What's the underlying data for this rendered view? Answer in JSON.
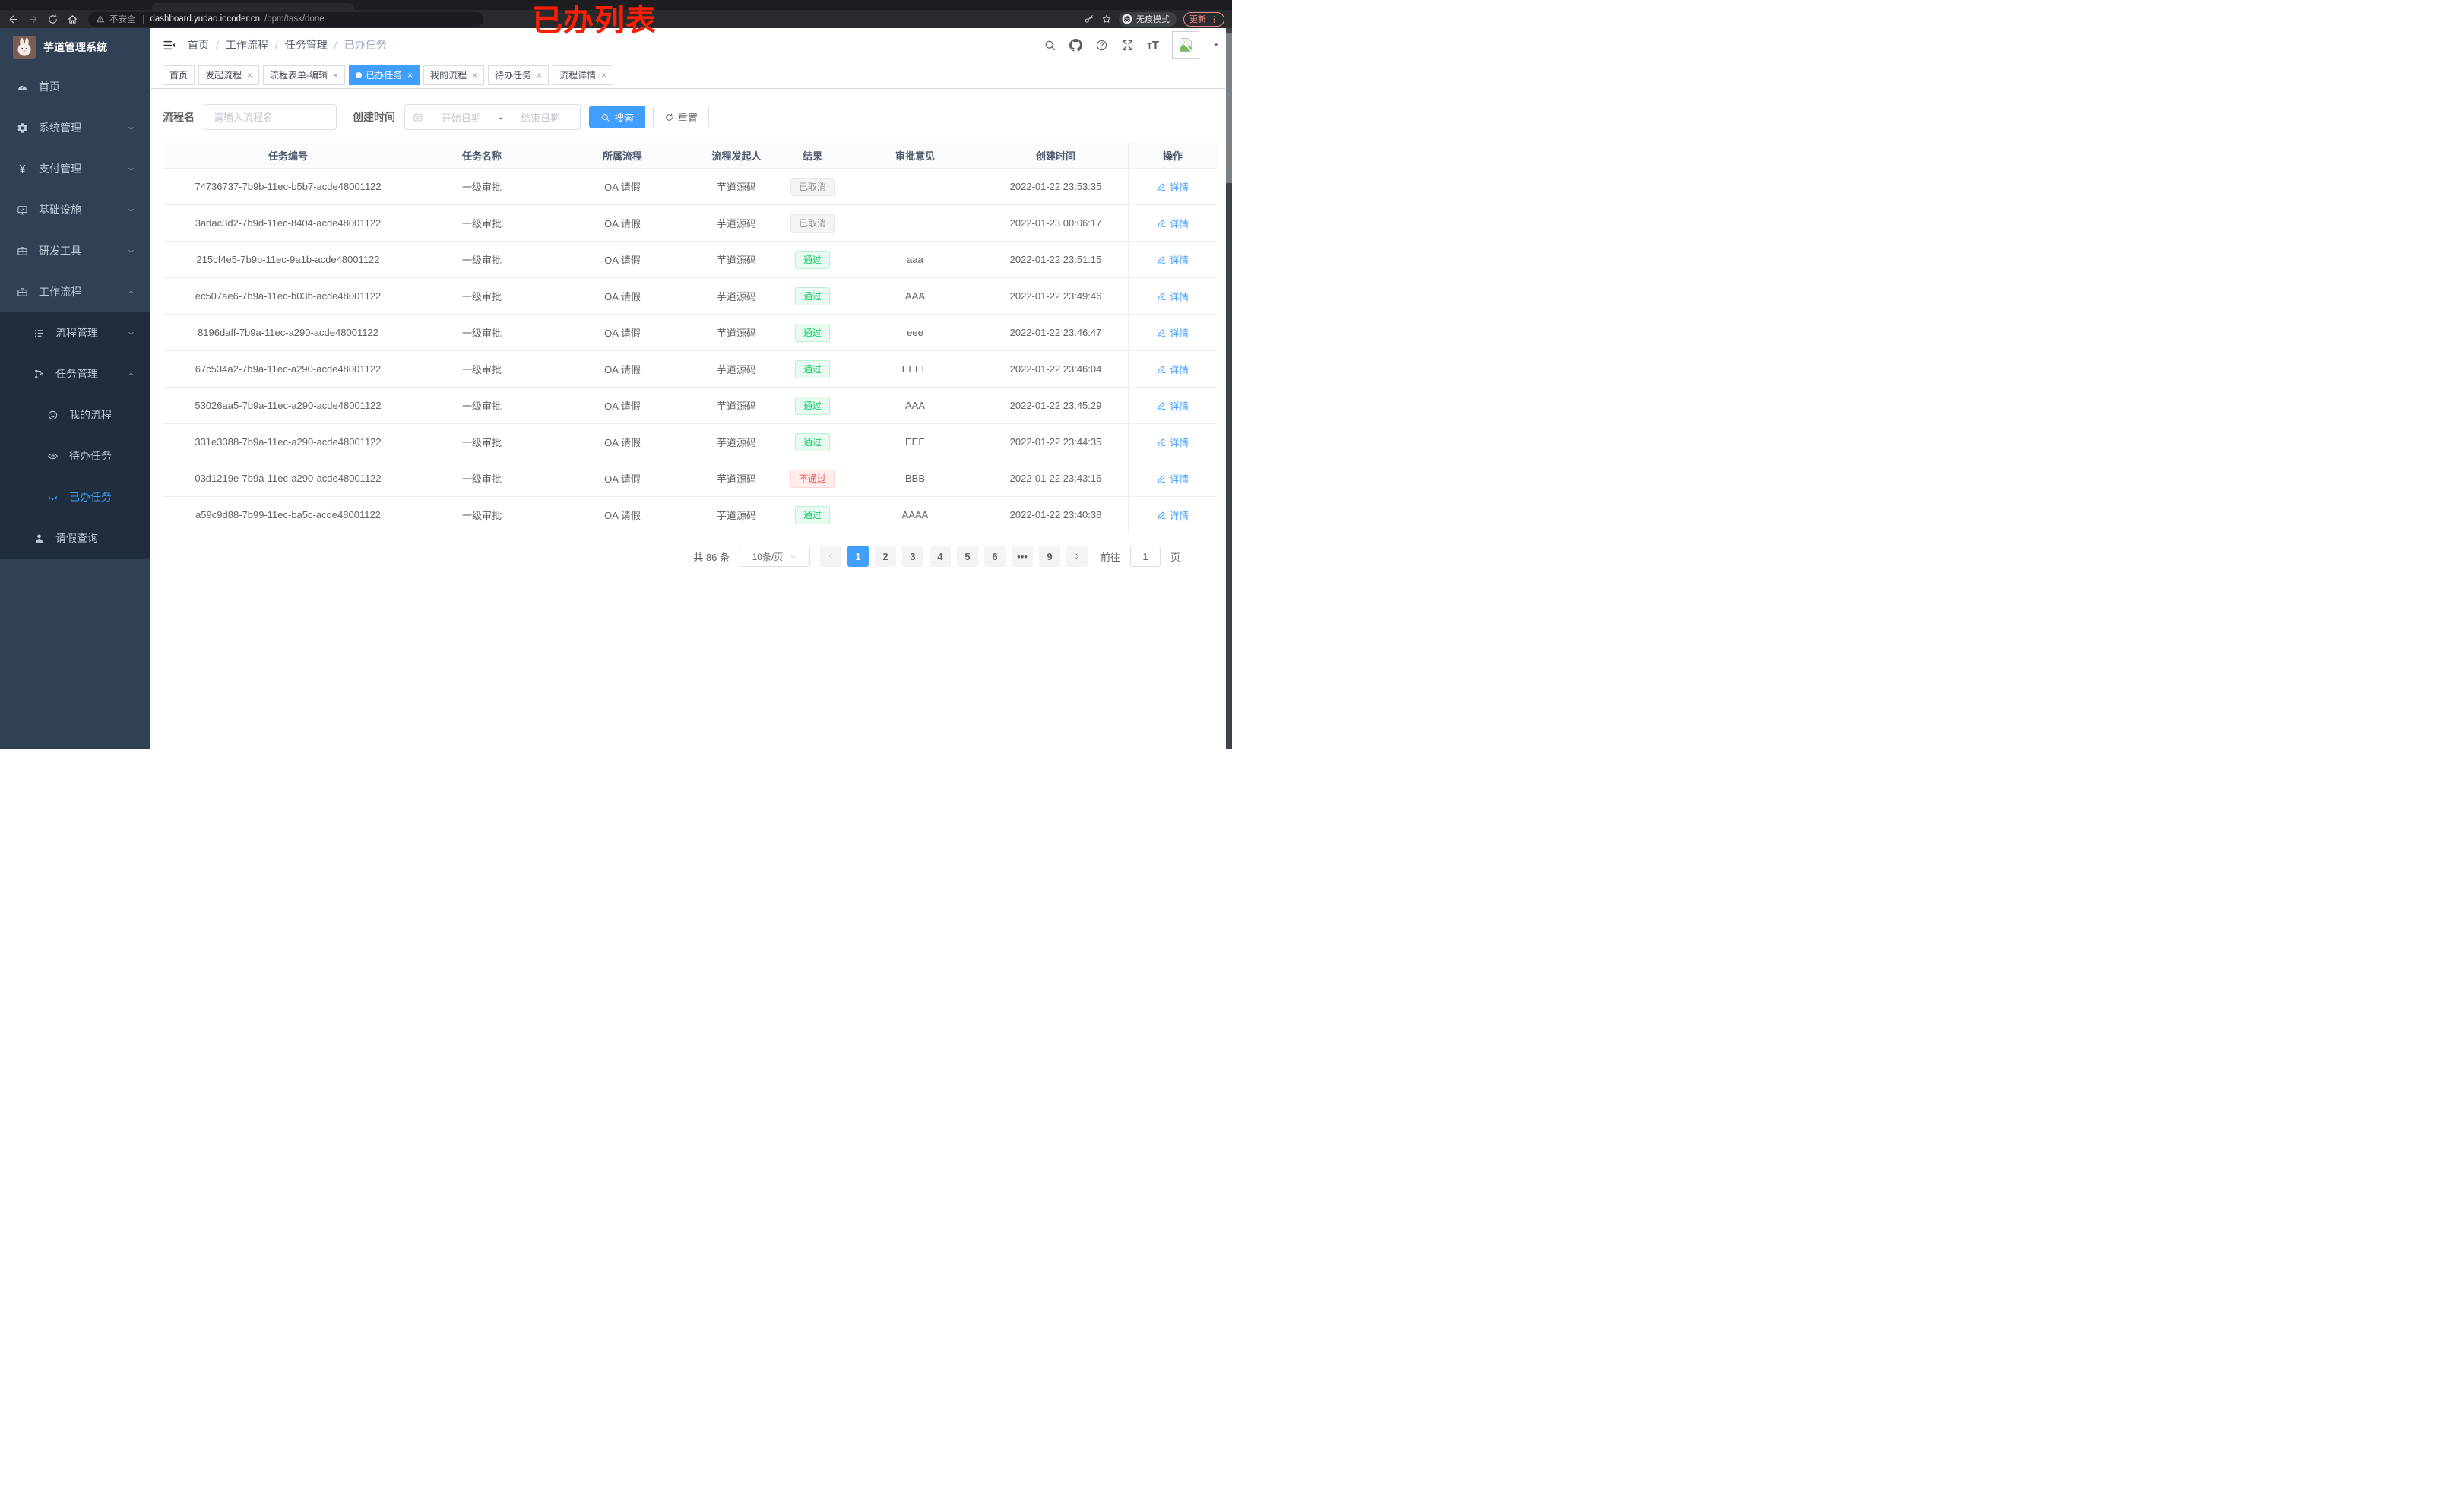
{
  "browser": {
    "security_label": "不安全",
    "url_host": "dashboard.yudao.iocoder.cn",
    "url_path": "/bpm/task/done",
    "incognito_label": "无痕模式",
    "update_label": "更新",
    "annotation": "已办列表"
  },
  "sidebar": {
    "logo_title": "芋道管理系统",
    "menu": [
      {
        "key": "home",
        "label": "首页",
        "icon": "gauge-icon",
        "level": 1,
        "submenu": false
      },
      {
        "key": "system",
        "label": "系统管理",
        "icon": "gear-icon",
        "level": 1,
        "arrow": "down",
        "submenu": false
      },
      {
        "key": "payment",
        "label": "支付管理",
        "icon": "yen-icon",
        "level": 1,
        "arrow": "down",
        "submenu": false
      },
      {
        "key": "infrastructure",
        "label": "基础设施",
        "icon": "monitor-icon",
        "level": 1,
        "arrow": "down",
        "submenu": false
      },
      {
        "key": "dev-tools",
        "label": "研发工具",
        "icon": "toolbox-icon",
        "level": 1,
        "arrow": "down",
        "submenu": false
      },
      {
        "key": "workflow",
        "label": "工作流程",
        "icon": "briefcase-icon",
        "level": 1,
        "arrow": "up",
        "submenu": false
      },
      {
        "key": "process-mgmt",
        "label": "流程管理",
        "icon": "list-icon",
        "level": 2,
        "arrow": "down",
        "submenu": true
      },
      {
        "key": "task-mgmt",
        "label": "任务管理",
        "icon": "flow-icon",
        "level": 2,
        "arrow": "up",
        "submenu": true
      },
      {
        "key": "my-process",
        "label": "我的流程",
        "icon": "face-icon",
        "level": 3,
        "submenu": true
      },
      {
        "key": "todo-tasks",
        "label": "待办任务",
        "icon": "eye-open-icon",
        "level": 3,
        "submenu": true
      },
      {
        "key": "done-tasks",
        "label": "已办任务",
        "icon": "eye-closed-icon",
        "level": 3,
        "submenu": true,
        "active": true
      },
      {
        "key": "leave-query",
        "label": "请假查询",
        "icon": "user-icon",
        "level": 2,
        "submenu": true
      }
    ]
  },
  "header": {
    "breadcrumb": [
      "首页",
      "工作流程",
      "任务管理",
      "已办任务"
    ]
  },
  "tabs": [
    {
      "key": "home",
      "label": "首页",
      "closable": false,
      "active": false
    },
    {
      "key": "start-process",
      "label": "发起流程",
      "closable": true,
      "active": false
    },
    {
      "key": "form-edit",
      "label": "流程表单-编辑",
      "closable": true,
      "active": false
    },
    {
      "key": "done-tasks",
      "label": "已办任务",
      "closable": true,
      "active": true
    },
    {
      "key": "my-process",
      "label": "我的流程",
      "closable": true,
      "active": false
    },
    {
      "key": "todo-tasks",
      "label": "待办任务",
      "closable": true,
      "active": false
    },
    {
      "key": "process-detail",
      "label": "流程详情",
      "closable": true,
      "active": false
    }
  ],
  "filters": {
    "name_label": "流程名",
    "name_placeholder": "请输入流程名",
    "time_label": "创建时间",
    "start_placeholder": "开始日期",
    "range_separator": "-",
    "end_placeholder": "结束日期",
    "search_label": "搜索",
    "reset_label": "重置"
  },
  "table": {
    "columns": [
      "任务编号",
      "任务名称",
      "所属流程",
      "流程发起人",
      "结果",
      "审批意见",
      "创建时间",
      "操作"
    ],
    "detail_label": "详情",
    "rows": [
      {
        "id": "74736737-7b9b-11ec-b5b7-acde48001122",
        "name": "一级审批",
        "process": "OA 请假",
        "starter": "芋道源码",
        "result": "已取消",
        "result_type": "info",
        "comment": "",
        "time": "2022-01-22 23:53:35"
      },
      {
        "id": "3adac3d2-7b9d-11ec-8404-acde48001122",
        "name": "一级审批",
        "process": "OA 请假",
        "starter": "芋道源码",
        "result": "已取消",
        "result_type": "info",
        "comment": "",
        "time": "2022-01-23 00:06:17"
      },
      {
        "id": "215cf4e5-7b9b-11ec-9a1b-acde48001122",
        "name": "一级审批",
        "process": "OA 请假",
        "starter": "芋道源码",
        "result": "通过",
        "result_type": "success",
        "comment": "aaa",
        "time": "2022-01-22 23:51:15"
      },
      {
        "id": "ec507ae6-7b9a-11ec-b03b-acde48001122",
        "name": "一级审批",
        "process": "OA 请假",
        "starter": "芋道源码",
        "result": "通过",
        "result_type": "success",
        "comment": "AAA",
        "time": "2022-01-22 23:49:46"
      },
      {
        "id": "8196daff-7b9a-11ec-a290-acde48001122",
        "name": "一级审批",
        "process": "OA 请假",
        "starter": "芋道源码",
        "result": "通过",
        "result_type": "success",
        "comment": "eee",
        "time": "2022-01-22 23:46:47"
      },
      {
        "id": "67c534a2-7b9a-11ec-a290-acde48001122",
        "name": "一级审批",
        "process": "OA 请假",
        "starter": "芋道源码",
        "result": "通过",
        "result_type": "success",
        "comment": "EEEE",
        "time": "2022-01-22 23:46:04"
      },
      {
        "id": "53026aa5-7b9a-11ec-a290-acde48001122",
        "name": "一级审批",
        "process": "OA 请假",
        "starter": "芋道源码",
        "result": "通过",
        "result_type": "success",
        "comment": "AAA",
        "time": "2022-01-22 23:45:29"
      },
      {
        "id": "331e3388-7b9a-11ec-a290-acde48001122",
        "name": "一级审批",
        "process": "OA 请假",
        "starter": "芋道源码",
        "result": "通过",
        "result_type": "success",
        "comment": "EEE",
        "time": "2022-01-22 23:44:35"
      },
      {
        "id": "03d1219e-7b9a-11ec-a290-acde48001122",
        "name": "一级审批",
        "process": "OA 请假",
        "starter": "芋道源码",
        "result": "不通过",
        "result_type": "danger",
        "comment": "BBB",
        "time": "2022-01-22 23:43:16"
      },
      {
        "id": "a59c9d88-7b99-11ec-ba5c-acde48001122",
        "name": "一级审批",
        "process": "OA 请假",
        "starter": "芋道源码",
        "result": "通过",
        "result_type": "success",
        "comment": "AAAA",
        "time": "2022-01-22 23:40:38"
      }
    ]
  },
  "pagination": {
    "total_label": "共 86 条",
    "page_size": "10条/页",
    "pages": [
      "1",
      "2",
      "3",
      "4",
      "5",
      "6",
      "•••",
      "9"
    ],
    "active_page": "1",
    "goto_label": "前往",
    "goto_value": "1",
    "page_label": "页"
  },
  "colors": {
    "accent": "#409eff",
    "sidebar_bg": "#304156",
    "submenu_bg": "#1f2d3d",
    "success": "#13ce66",
    "danger": "#ff4949",
    "info": "#909399",
    "annotation": "#ff1e00"
  }
}
